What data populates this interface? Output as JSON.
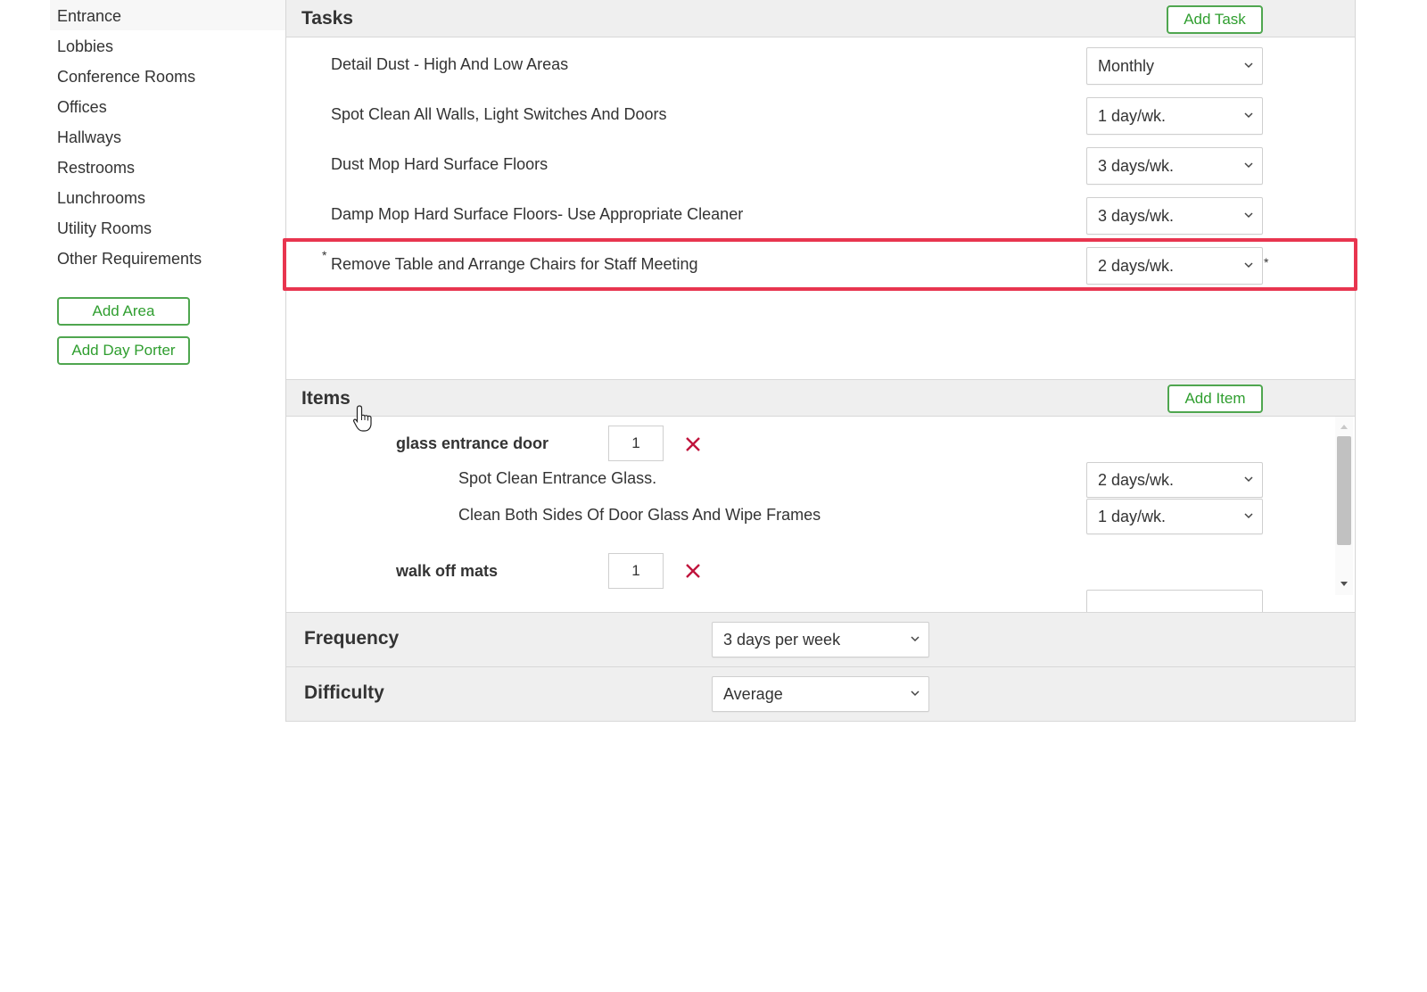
{
  "sidebar": {
    "items": [
      {
        "label": "Entrance"
      },
      {
        "label": "Lobbies"
      },
      {
        "label": "Conference Rooms"
      },
      {
        "label": "Offices"
      },
      {
        "label": "Hallways"
      },
      {
        "label": "Restrooms"
      },
      {
        "label": "Lunchrooms"
      },
      {
        "label": "Utility Rooms"
      },
      {
        "label": "Other Requirements"
      }
    ],
    "add_area_label": "Add Area",
    "add_day_porter_label": "Add Day Porter"
  },
  "tasks": {
    "title": "Tasks",
    "add_task_label": "Add Task",
    "rows": [
      {
        "label": "Detail Dust - High And Low Areas",
        "frequency": "Monthly"
      },
      {
        "label": "Spot Clean All Walls, Light Switches And Doors",
        "frequency": "1 day/wk."
      },
      {
        "label": "Dust Mop Hard Surface Floors",
        "frequency": "3 days/wk."
      },
      {
        "label": "Damp Mop Hard Surface Floors- Use Appropriate Cleaner",
        "frequency": "3 days/wk."
      },
      {
        "label": "Remove Table and Arrange Chairs for Staff Meeting",
        "frequency": "2 days/wk.",
        "custom_marker": "*"
      }
    ]
  },
  "items": {
    "title": "Items",
    "add_item_label": "Add Item",
    "list": [
      {
        "name": "glass entrance door",
        "quantity": "1",
        "tasks": [
          {
            "label": "Spot Clean Entrance Glass.",
            "frequency": "2 days/wk."
          },
          {
            "label": "Clean Both Sides Of Door Glass And Wipe Frames",
            "frequency": "1 day/wk."
          }
        ]
      },
      {
        "name": "walk off mats",
        "quantity": "1"
      }
    ]
  },
  "frequency": {
    "label": "Frequency",
    "value": "3 days per week"
  },
  "difficulty": {
    "label": "Difficulty",
    "value": "Average"
  },
  "colors": {
    "accent_green": "#2f9e2f",
    "highlight_red": "#e8354f",
    "remove_red": "#c0143c"
  }
}
